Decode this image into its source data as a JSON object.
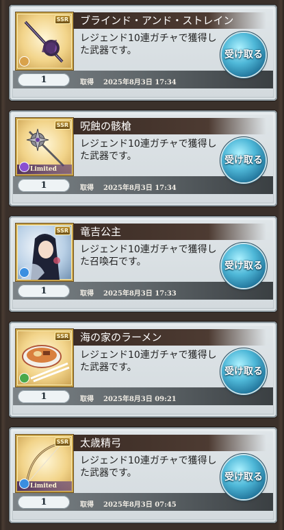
{
  "items": [
    {
      "title": "ブラインド・アンド・ストレイン",
      "description": "レジェンド10連ガチャで獲得した武器です。",
      "count": "1",
      "date_label": "取得",
      "date_value": "2025年8月3日 17:34",
      "rarity": "SSR",
      "element": "light",
      "element_color": "#d9a24a",
      "limited": false,
      "icon": "dark-scepter-icon",
      "button_label": "受け取る"
    },
    {
      "title": "呪蝕の骸槍",
      "description": "レジェンド10連ガチャで獲得した武器です。",
      "count": "1",
      "date_label": "取得",
      "date_value": "2025年8月3日 17:34",
      "rarity": "SSR",
      "element": "dark",
      "element_color": "#8a4fd0",
      "limited": true,
      "limited_label": "Limited",
      "icon": "spiked-spear-icon",
      "button_label": "受け取る"
    },
    {
      "title": "竜吉公主",
      "description": "レジェンド10連ガチャで獲得した召喚石です。",
      "count": "1",
      "date_label": "取得",
      "date_value": "2025年8月3日 17:33",
      "rarity": "SSR",
      "element": "water",
      "element_color": "#3a8ee0",
      "limited": false,
      "icon": "summon-portrait-icon",
      "button_label": "受け取る"
    },
    {
      "title": "海の家のラーメン",
      "description": "レジェンド10連ガチャで獲得した武器です。",
      "count": "1",
      "date_label": "取得",
      "date_value": "2025年8月3日 09:21",
      "rarity": "SSR",
      "element": "wind",
      "element_color": "#4aa84a",
      "limited": false,
      "icon": "ramen-bowl-icon",
      "button_label": "受け取る"
    },
    {
      "title": "太歳精弓",
      "description": "レジェンド10連ガチャで獲得した武器です。",
      "count": "1",
      "date_label": "取得",
      "date_value": "2025年8月3日 07:45",
      "rarity": "SSR",
      "element": "water",
      "element_color": "#3a8ee0",
      "limited": true,
      "limited_label": "Limited",
      "icon": "bow-icon",
      "button_label": "受け取る"
    }
  ]
}
